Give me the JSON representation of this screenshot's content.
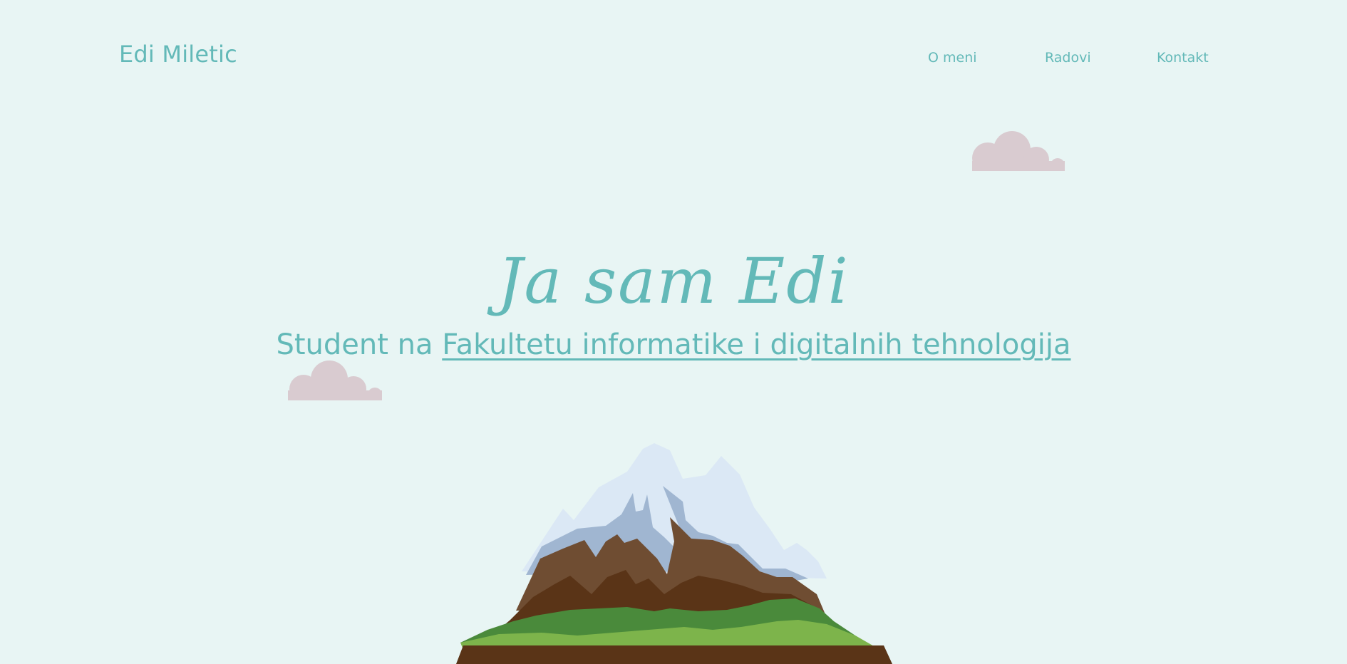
{
  "header": {
    "brand": "Edi Miletic",
    "nav": [
      "O meni",
      "Radovi",
      "Kontakt"
    ]
  },
  "hero": {
    "title": "Ja sam Edi",
    "subtitle_prefix": "Student na ",
    "subtitle_link": "Fakultetu informatike i digitalnih tehnologija"
  },
  "colors": {
    "background": "#e8f5f4",
    "accent": "#63b9b8",
    "cloud": "#d9cbd0"
  },
  "icons": {
    "cloud_top_right": "cloud-icon",
    "cloud_left": "cloud-icon",
    "mountain": "mountain-illustration"
  }
}
